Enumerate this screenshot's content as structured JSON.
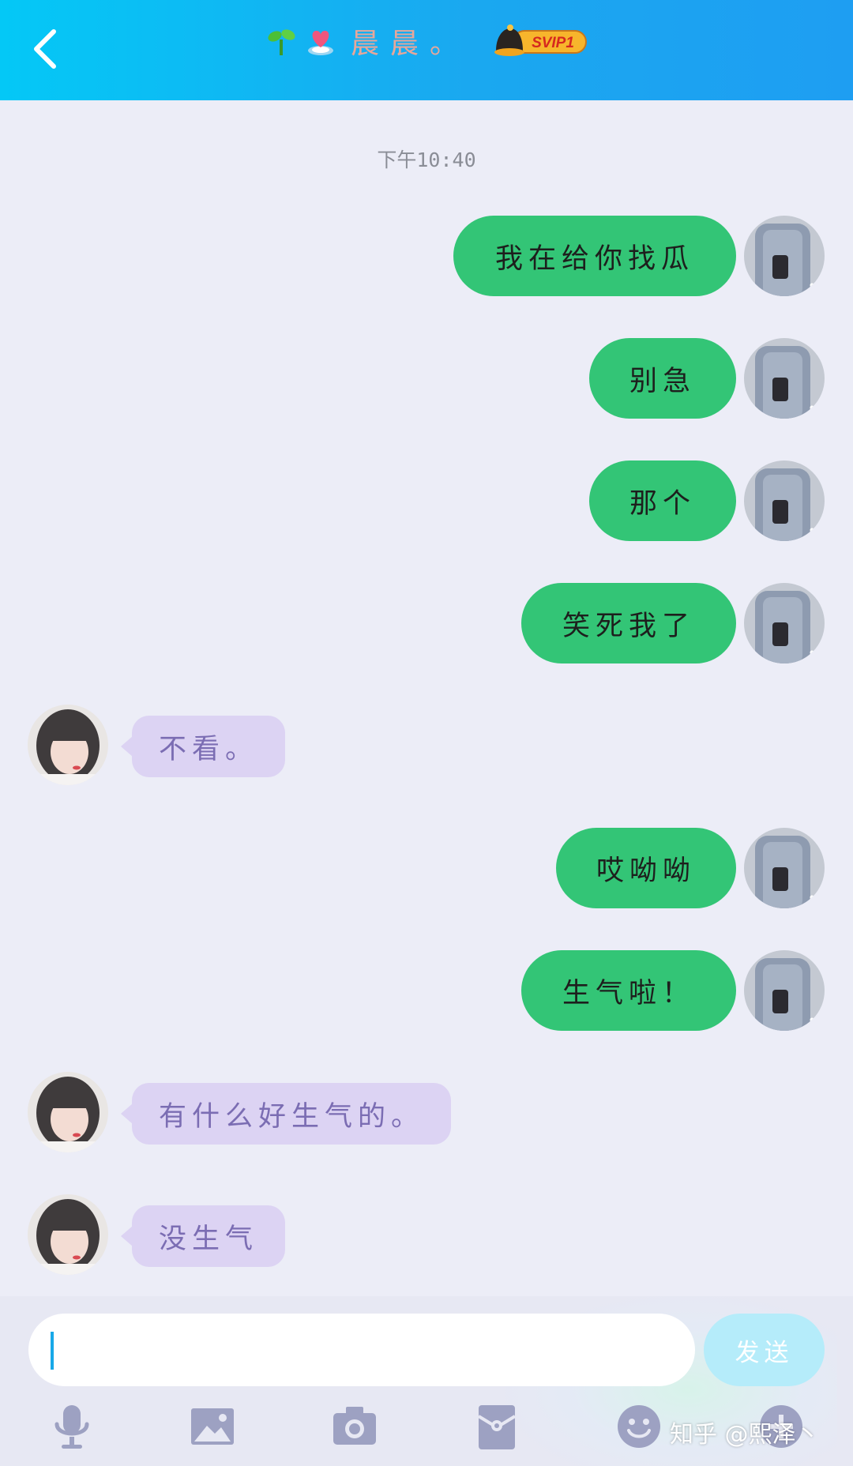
{
  "header": {
    "title": "晨晨。",
    "vip_badge": "SVIP1",
    "back_icon": "chevron-left-icon",
    "emoji_icons": [
      "sprout-icon",
      "heart-gift-icon"
    ],
    "colors": {
      "gradient_start": "#04c8f6",
      "gradient_end": "#1e9ef2",
      "title": "#e7a79b"
    }
  },
  "chat": {
    "timestamp": "下午10:40",
    "messages": [
      {
        "from": "me",
        "text": "我在给你找瓜"
      },
      {
        "from": "me",
        "text": "别急"
      },
      {
        "from": "me",
        "text": "那个"
      },
      {
        "from": "me",
        "text": "笑死我了"
      },
      {
        "from": "them",
        "text": "不看。"
      },
      {
        "from": "me",
        "text": "哎呦呦"
      },
      {
        "from": "me",
        "text": "生气啦！"
      },
      {
        "from": "them",
        "text": "有什么好生气的。"
      },
      {
        "from": "them",
        "text": "没生气"
      }
    ],
    "colors": {
      "outgoing_bubble": "#33c576",
      "incoming_bubble": "#dcd3f3",
      "incoming_text": "#7b6db3"
    }
  },
  "composer": {
    "input_value": "",
    "send_label": "发送"
  },
  "toolbar": {
    "icons": [
      "microphone-icon",
      "image-icon",
      "camera-icon",
      "red-packet-icon",
      "emoji-icon",
      "plus-icon"
    ]
  },
  "watermark": "知乎 @熙泽丶"
}
